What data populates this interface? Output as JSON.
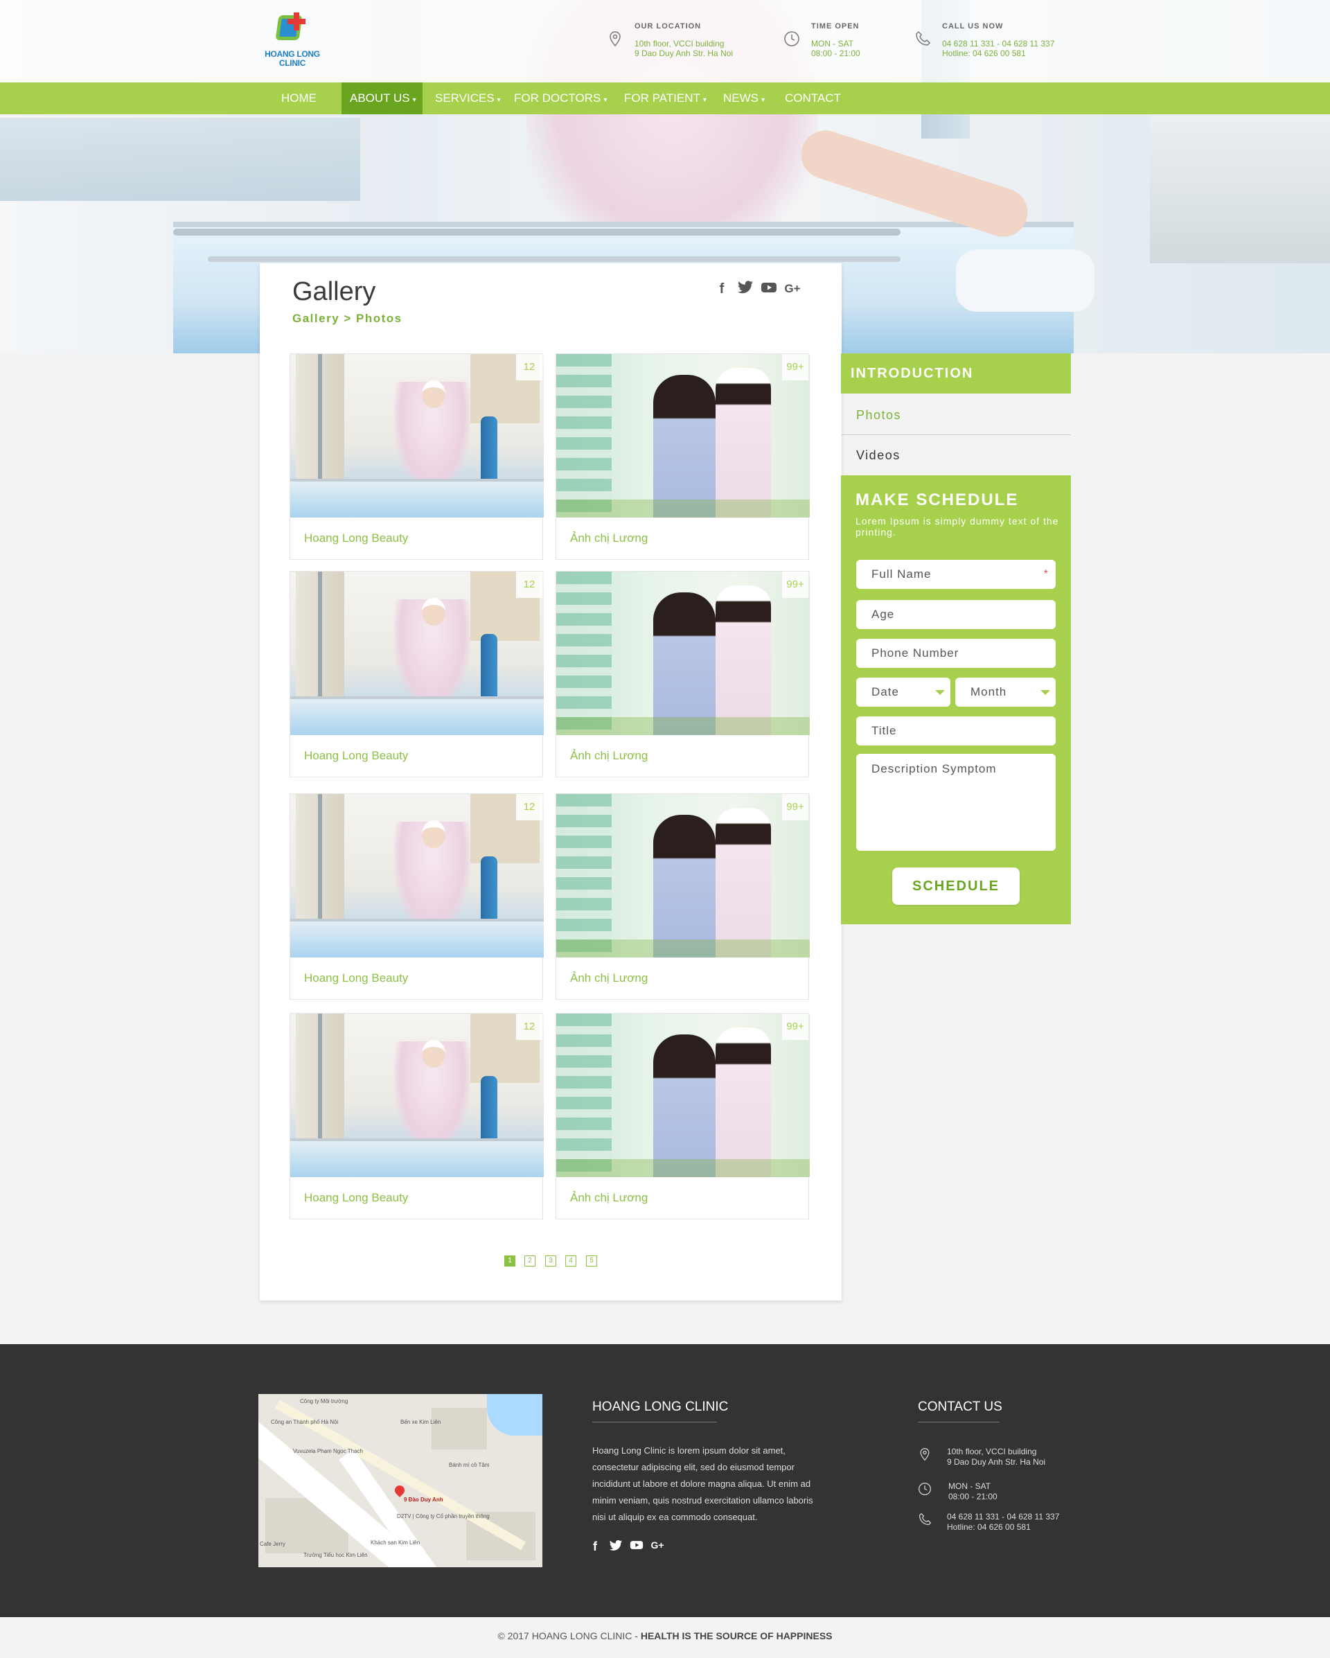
{
  "brand": {
    "logo_line1": "HOANG LONG",
    "logo_line2": "CLINIC",
    "colors": {
      "accent": "#a7d04c",
      "accent_dark": "#6aa520",
      "text_green": "#7ab239",
      "footer_bg": "#333333"
    }
  },
  "header": {
    "location": {
      "title": "OUR LOCATION",
      "line1": "10th floor, VCCI building",
      "line2": "9 Dao Duy Anh Str. Ha Noi",
      "icon": "map-pin-icon"
    },
    "time": {
      "title": "TIME OPEN",
      "line1": "MON - SAT",
      "line2": "08:00 - 21:00",
      "icon": "clock-icon"
    },
    "call": {
      "title": "CALL US NOW",
      "line1": "04 628 11 331 - 04 628 11 337",
      "line2": "Hotline:  04 626 00 581",
      "icon": "phone-icon"
    }
  },
  "nav": {
    "items": [
      {
        "label": "HOME",
        "caret": ""
      },
      {
        "label": "ABOUT US",
        "caret": "▾"
      },
      {
        "label": "SERVICES",
        "caret": "▾"
      },
      {
        "label": "FOR DOCTORS",
        "caret": "▾"
      },
      {
        "label": "FOR PATIENT",
        "caret": "▾"
      },
      {
        "label": "NEWS",
        "caret": "▾"
      },
      {
        "label": "CONTACT",
        "caret": ""
      }
    ],
    "active_index": 1
  },
  "gallery": {
    "title": "Gallery",
    "breadcrumb": "Gallery > Photos",
    "social": [
      "f",
      "t",
      "▶",
      "G+"
    ],
    "tiles": [
      {
        "caption": "Hoang Long Beauty",
        "count": "12"
      },
      {
        "caption": "Ảnh chị Lương",
        "count": "99+"
      },
      {
        "caption": "Hoang Long Beauty",
        "count": "12"
      },
      {
        "caption": "Ảnh chị Lương",
        "count": "99+"
      },
      {
        "caption": "Hoang Long Beauty",
        "count": "12"
      },
      {
        "caption": "Ảnh chị Lương",
        "count": "99+"
      },
      {
        "caption": "Hoang Long Beauty",
        "count": "12"
      },
      {
        "caption": "Ảnh chị Lương",
        "count": "99+"
      }
    ],
    "pages": [
      "1",
      "2",
      "3",
      "4",
      "5"
    ],
    "current_page": 1
  },
  "sidebar": {
    "heading": "INTRODUCTION",
    "links": [
      "Photos",
      "Videos"
    ]
  },
  "schedule": {
    "title": "MAKE SCHEDULE",
    "subtitle": "Lorem Ipsum is simply dummy text of the printing.",
    "full_name": "Full Name",
    "required_mark": "*",
    "age": "Age",
    "phone": "Phone Number",
    "date": "Date",
    "month": "Month",
    "title_field": "Title",
    "description": "Description Symptom",
    "button": "SCHEDULE"
  },
  "footer": {
    "about_title": "HOANG LONG CLINIC",
    "about_text": "Hoang Long Clinic is lorem ipsum dolor sit amet, consectetur adipiscing elit, sed do eiusmod tempor incididunt ut labore et dolore magna aliqua. Ut enim ad minim veniam, quis nostrud exercitation ullamco laboris nisi ut aliquip ex ea commodo consequat.",
    "social": [
      "f",
      "t",
      "▶",
      "G+"
    ],
    "contact_title": "CONTACT US",
    "contact": {
      "addr1": "10th floor, VCCI building",
      "addr2": "9 Dao Duy Anh Str. Ha Noi",
      "time1": "MON - SAT",
      "time2": "08:00 - 21:00",
      "phone1": "04 628 11 331 - 04 628 11 337",
      "phone2": "Hotline:  04 626 00 581"
    },
    "map_labels": {
      "pin": "9 Đào Duy Anh",
      "l1": "Công ty Môi trường",
      "l2": "Công an Thành phố Hà Nội",
      "l3": "Bến xe Kim Liên",
      "l4": "Vuvuzela Phạm Ngọc Thạch",
      "l5": "Bánh mì cô Tâm",
      "l6": "D2TV | Công ty Cổ phần truyền thông",
      "l7": "Khách sạn Kim Liên",
      "l8": "Trường Tiểu học Kim Liên",
      "l9": "Cafe Jerry"
    }
  },
  "copyright": {
    "prefix": "© 2017  HOANG LONG CLINIC - ",
    "tagline": "HEALTH IS THE SOURCE OF HAPPINESS"
  }
}
